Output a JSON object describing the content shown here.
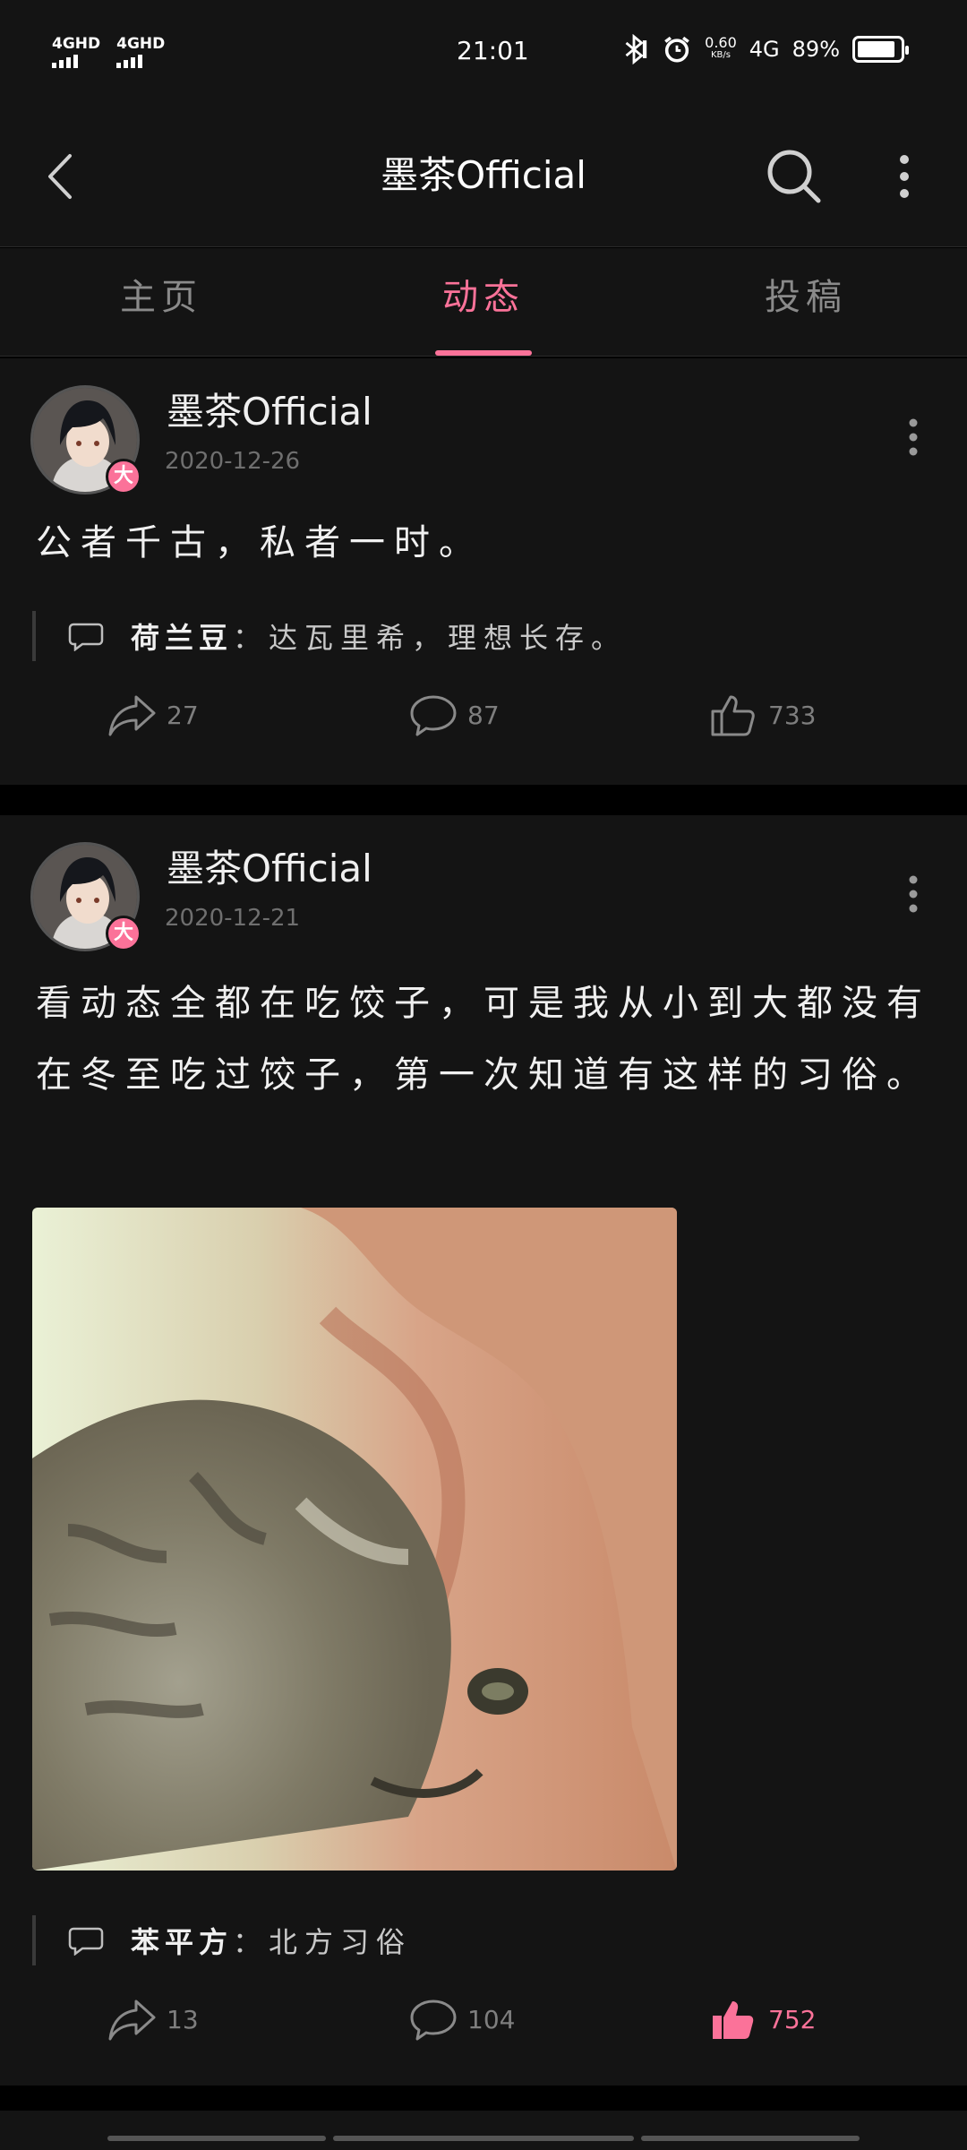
{
  "status_bar": {
    "sim1": "4GHD",
    "sim2": "4GHD",
    "time": "21:01",
    "net_speed": "0.60",
    "net_unit": "KB/s",
    "network": "4G",
    "battery": "89%",
    "battery_level": 0.89
  },
  "header": {
    "title": "墨茶Official",
    "back_icon": "chevron-left-icon",
    "search_icon": "search-icon",
    "more_icon": "more-vertical-icon"
  },
  "tabs": [
    {
      "label": "主页",
      "active": false
    },
    {
      "label": "动态",
      "active": true
    },
    {
      "label": "投稿",
      "active": false
    }
  ],
  "accent_color": "#fb7299",
  "posts": [
    {
      "author": "墨茶Official",
      "badge": "大",
      "date": "2020-12-26",
      "text": "公者千古，私者一时。",
      "comment_user": "荷兰豆",
      "comment_text": "达瓦里希，理想长存。",
      "shares": "27",
      "comments": "87",
      "likes": "733",
      "liked": false
    },
    {
      "author": "墨茶Official",
      "badge": "大",
      "date": "2020-12-21",
      "text": "看动态全都在吃饺子，可是我从小到大都没有在冬至吃过饺子，第一次知道有这样的习俗。",
      "comment_user": "苯平方",
      "comment_text": "北方习俗",
      "shares": "13",
      "comments": "104",
      "likes": "752",
      "liked": true
    }
  ]
}
